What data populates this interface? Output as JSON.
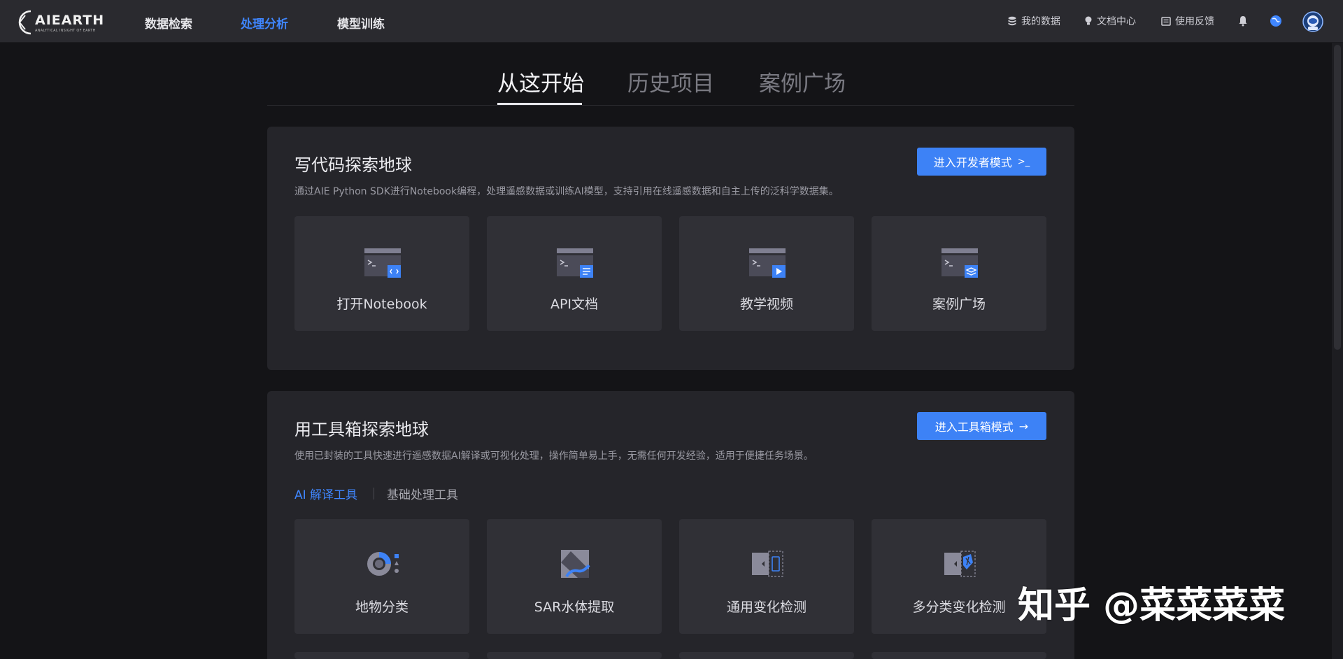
{
  "header": {
    "logo_text": "AIEARTH",
    "logo_sub": "ANALYTICAL INSIGHT OF EARTH",
    "nav": [
      {
        "label": "数据检索",
        "active": false
      },
      {
        "label": "处理分析",
        "active": true
      },
      {
        "label": "模型训练",
        "active": false
      }
    ],
    "right": {
      "my_data": "我的数据",
      "docs": "文档中心",
      "feedback": "使用反馈"
    }
  },
  "tabs": [
    {
      "label": "从这开始",
      "active": true
    },
    {
      "label": "历史项目",
      "active": false
    },
    {
      "label": "案例广场",
      "active": false
    }
  ],
  "code_panel": {
    "title": "写代码探索地球",
    "desc": "通过AIE Python SDK进行Notebook编程，处理遥感数据或训练AI模型，支持引用在线遥感数据和自主上传的泛科学数据集。",
    "button": "进入开发者模式",
    "button_icon": ">_",
    "tiles": [
      {
        "label": "打开Notebook",
        "icon": "code-icon"
      },
      {
        "label": "API文档",
        "icon": "document-icon"
      },
      {
        "label": "教学视频",
        "icon": "video-icon"
      },
      {
        "label": "案例广场",
        "icon": "layers-icon"
      }
    ]
  },
  "toolbox_panel": {
    "title": "用工具箱探索地球",
    "desc": "使用已封装的工具快速进行遥感数据AI解译或可视化处理，操作简单易上手，无需任何开发经验，适用于便捷任务场景。",
    "button": "进入工具箱模式",
    "button_icon": "→",
    "subtabs": [
      {
        "label": "AI 解译工具",
        "active": true
      },
      {
        "label": "基础处理工具",
        "active": false
      }
    ],
    "tiles": [
      {
        "label": "地物分类",
        "icon": "classification-icon"
      },
      {
        "label": "SAR水体提取",
        "icon": "sar-water-icon"
      },
      {
        "label": "通用变化检测",
        "icon": "change-detection-icon"
      },
      {
        "label": "多分类变化检测",
        "icon": "multi-change-detection-icon"
      }
    ]
  },
  "watermark": "知乎 @菜菜菜菜",
  "colors": {
    "accent": "#3d82f6",
    "background": "#141417",
    "panel": "#25252a",
    "tile": "#303036"
  }
}
